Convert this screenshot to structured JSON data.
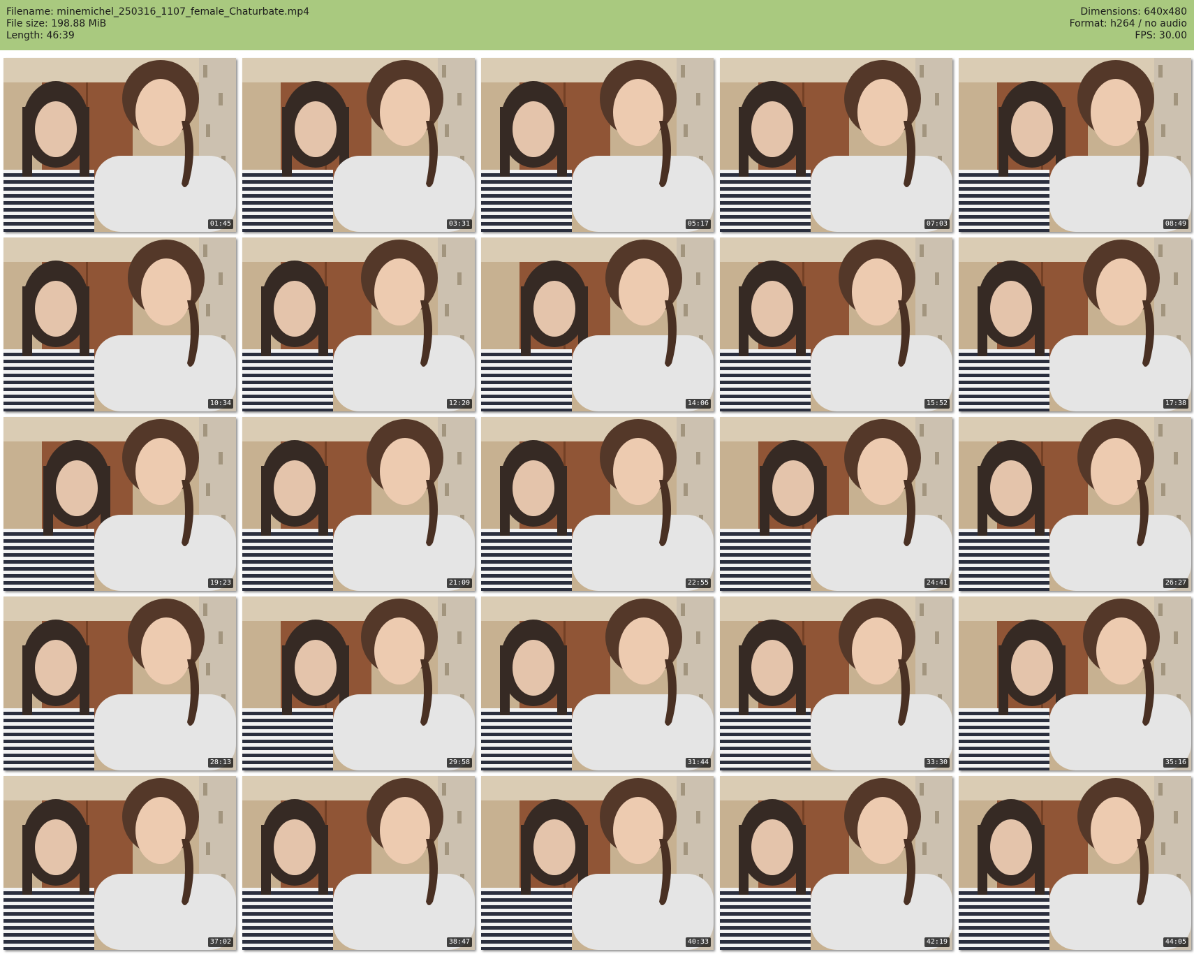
{
  "header": {
    "filename_line": "Filename: minemichel_250316_1107_female_Chaturbate.mp4",
    "filesize_line": "File size: 198.88 MiB",
    "length_line": "Length: 46:39",
    "dimensions_line": "Dimensions: 640x480",
    "format_line": "Format: h264 / no audio",
    "fps_line": "FPS: 30.00"
  },
  "colors": {
    "header_bg": "#a9c97f",
    "page_bg": "#ffffff"
  },
  "thumbnails": [
    {
      "time": "01:45"
    },
    {
      "time": "03:31"
    },
    {
      "time": "05:17"
    },
    {
      "time": "07:03"
    },
    {
      "time": "08:49"
    },
    {
      "time": "10:34"
    },
    {
      "time": "12:20"
    },
    {
      "time": "14:06"
    },
    {
      "time": "15:52"
    },
    {
      "time": "17:38"
    },
    {
      "time": "19:23"
    },
    {
      "time": "21:09"
    },
    {
      "time": "22:55"
    },
    {
      "time": "24:41"
    },
    {
      "time": "26:27"
    },
    {
      "time": "28:13"
    },
    {
      "time": "29:58"
    },
    {
      "time": "31:44"
    },
    {
      "time": "33:30"
    },
    {
      "time": "35:16"
    },
    {
      "time": "37:02"
    },
    {
      "time": "38:47"
    },
    {
      "time": "40:33"
    },
    {
      "time": "42:19"
    },
    {
      "time": "44:05"
    }
  ]
}
